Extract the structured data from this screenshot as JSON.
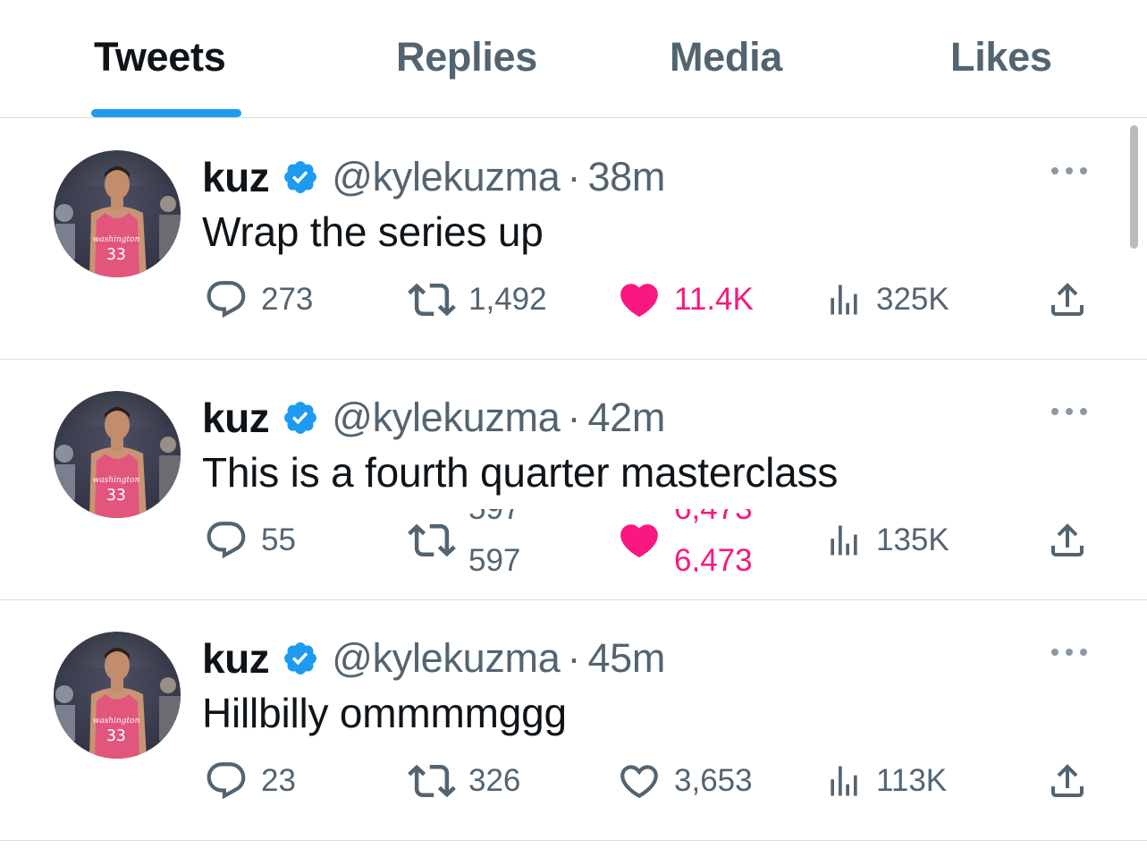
{
  "tabs": [
    {
      "label": "Tweets",
      "active": true
    },
    {
      "label": "Replies",
      "active": false
    },
    {
      "label": "Media",
      "active": false
    },
    {
      "label": "Likes",
      "active": false
    }
  ],
  "colors": {
    "accent": "#1d9bf0",
    "like_pink": "#f91880",
    "secondary_text": "#536471",
    "primary_text": "#0f1419"
  },
  "tweets": [
    {
      "name": "kuz",
      "handle": "@kylekuzma",
      "separator": "·",
      "time": "38m",
      "text": "Wrap the series up",
      "replies": "273",
      "retweets": "1,492",
      "likes": "11.4K",
      "liked": true,
      "views": "325K"
    },
    {
      "name": "kuz",
      "handle": "@kylekuzma",
      "separator": "·",
      "time": "42m",
      "text": "This is a fourth quarter masterclass",
      "replies": "55",
      "retweets_previous": "597",
      "retweets": "597",
      "likes_previous": "6,473",
      "likes": "6,473",
      "liked": true,
      "views": "135K"
    },
    {
      "name": "kuz",
      "handle": "@kylekuzma",
      "separator": "·",
      "time": "45m",
      "text": "Hillbilly ommmmggg",
      "replies": "23",
      "retweets": "326",
      "likes": "3,653",
      "liked": false,
      "views": "113K"
    }
  ]
}
